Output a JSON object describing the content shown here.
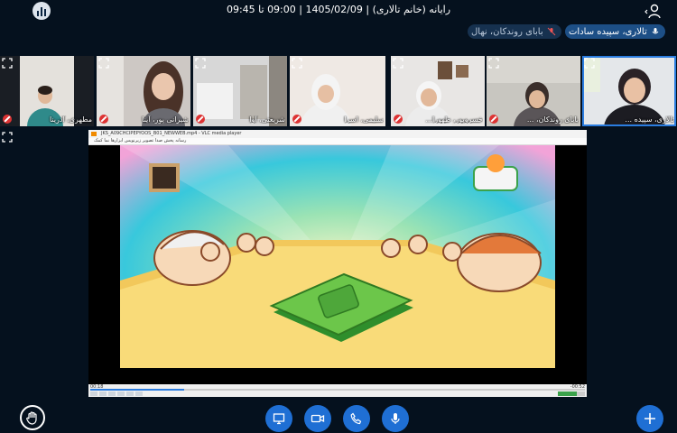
{
  "header": {
    "title": "رایانه (خانم تالاری) | 1405/02/09 | 09:00 تا 09:45",
    "stats_icon": "bar-chart-icon",
    "user_icon": "user-settings-icon"
  },
  "talking": {
    "primary": "تالاری، سپیده سادات",
    "secondary": "بابای روندکان، نهال"
  },
  "tiles": [
    {
      "name": "تالاری، سپیده ..."
    },
    {
      "name": "بابای روندکان، ..."
    },
    {
      "name": "خسروپور، طهورا..."
    },
    {
      "name": "سلیمی، اسرا"
    },
    {
      "name": "شریعتی، آوا"
    },
    {
      "name": "شیرانی پور، آینا"
    },
    {
      "name": "مطهری، آدرینا"
    }
  ],
  "share": {
    "window_title": "JKS_A09CHCIPEPYOOS_B01_NEWWEB.mp4 - VLC media player",
    "menu": "رسانه   پخش   صدا   تصویر   زیرنویس   ابزارها   نما   کمک",
    "time_elapsed": "00:18",
    "time_total": "-00:52",
    "progress": 0.19,
    "volume": 0.7
  },
  "controls": {
    "raise_hand": "hand-icon",
    "share_screen": "monitor-icon",
    "camera": "video-camera-icon",
    "audio": "phone-icon",
    "mic": "microphone-icon",
    "actions": "plus-icon"
  },
  "colors": {
    "accent": "#1f6fd4",
    "background": "#05111e",
    "muted": "#d33333"
  }
}
